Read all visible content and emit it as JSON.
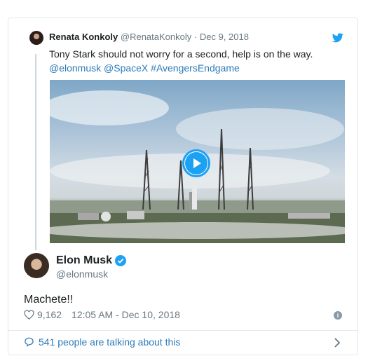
{
  "quoted_reply": {
    "author_name": "Renata Konkoly",
    "author_handle": "@RenataKonkoly",
    "separator": "·",
    "date": "Dec 9, 2018",
    "text": "Tony Stark should not worry for a second, help is on the way.",
    "links": "@elonmusk @SpaceX #AvengersEndgame",
    "media": "video",
    "icons": {
      "avatar": "avatar",
      "brand": "twitter-bird-icon",
      "play": "play-icon"
    }
  },
  "tweet": {
    "author_name": "Elon Musk",
    "author_handle": "@elonmusk",
    "verified": true,
    "text": "Machete!!",
    "like_count": "9,162",
    "timestamp": "12:05 AM - Dec 10, 2018",
    "info_glyph": "i"
  },
  "footer": {
    "talking_text": "541 people are talking about this"
  },
  "colors": {
    "link": "#2b7bb9",
    "brand": "#1da1f2",
    "muted": "#697882",
    "border": "#e1e8ed"
  }
}
